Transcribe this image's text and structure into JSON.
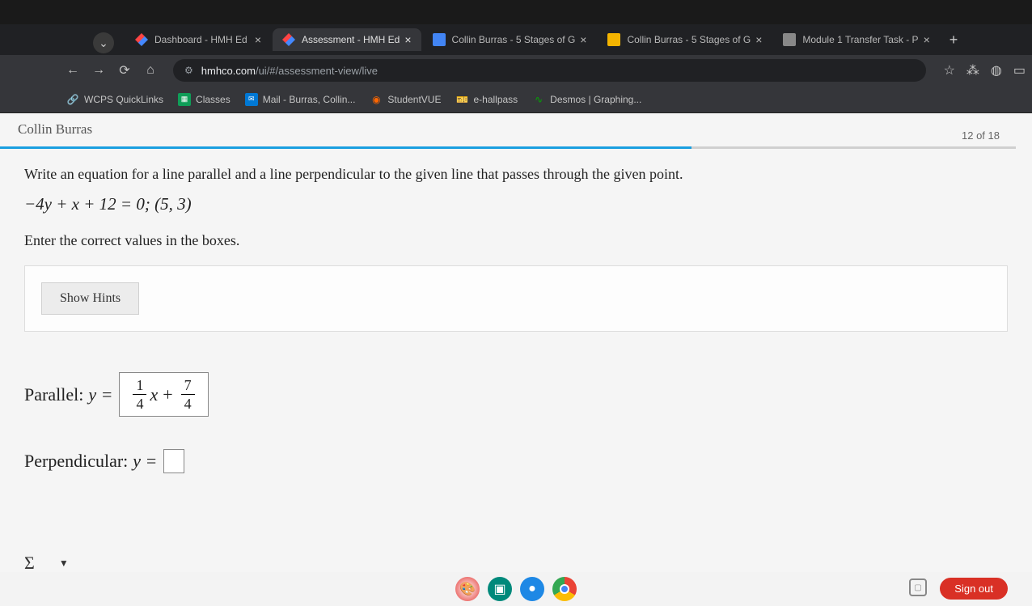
{
  "tabs": [
    {
      "title": "Dashboard - HMH Ed",
      "active": false,
      "favicon": "hmh"
    },
    {
      "title": "Assessment - HMH Ed",
      "active": true,
      "favicon": "hmh"
    },
    {
      "title": "Collin Burras - 5 Stages of G",
      "active": false,
      "favicon": "doc"
    },
    {
      "title": "Collin Burras - 5 Stages of G",
      "active": false,
      "favicon": "slides"
    },
    {
      "title": "Module 1 Transfer Task - P",
      "active": false,
      "favicon": "gen"
    }
  ],
  "url": {
    "domain": "hmhco.com",
    "path": "/ui/#/assessment-view/live"
  },
  "bookmarks": [
    {
      "label": "WCPS QuickLinks",
      "icon": "link"
    },
    {
      "label": "Classes",
      "icon": "classes"
    },
    {
      "label": "Mail - Burras, Collin...",
      "icon": "mail"
    },
    {
      "label": "StudentVUE",
      "icon": "vue"
    },
    {
      "label": "e-hallpass",
      "icon": "pass"
    },
    {
      "label": "Desmos | Graphing...",
      "icon": "desmos"
    }
  ],
  "student_name": "Collin Burras",
  "progress": "12 of 18",
  "question": {
    "instruction": "Write an equation for a line parallel and a line perpendicular to the given line that passes through the given point.",
    "equation": "−4y + x + 12 = 0; (5, 3)",
    "sub_instruction": "Enter the correct values in the boxes.",
    "hints_button": "Show Hints",
    "parallel_label": "Parallel: ",
    "perpendicular_label": "Perpendicular: ",
    "y_eq": "y =",
    "parallel_answer": {
      "frac1_num": "1",
      "frac1_den": "4",
      "var": "x",
      "op": "+",
      "frac2_num": "7",
      "frac2_den": "4"
    }
  },
  "toolbar": {
    "sigma": "Σ"
  },
  "signout": "Sign out"
}
